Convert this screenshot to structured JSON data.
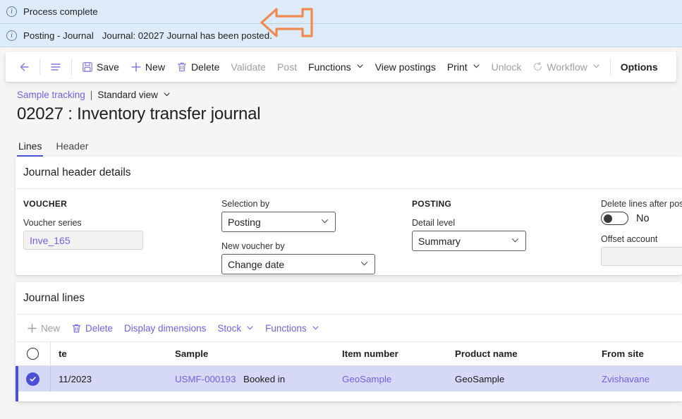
{
  "notifications": [
    {
      "icon": "info-icon",
      "title": "Process complete",
      "detail": ""
    },
    {
      "icon": "info-icon",
      "title": "Posting - Journal",
      "detail": "Journal: 02027 Journal has been posted."
    }
  ],
  "annotation": {
    "shape": "left-arrow",
    "color": "#f08a52"
  },
  "command_bar": {
    "back_label": "",
    "menu_label": "",
    "items": [
      {
        "label": "Save",
        "icon": "save-icon",
        "disabled": false,
        "caret": false
      },
      {
        "label": "New",
        "icon": "plus-icon",
        "disabled": false,
        "caret": false
      },
      {
        "label": "Delete",
        "icon": "trash-icon",
        "disabled": false,
        "caret": false
      },
      {
        "label": "Validate",
        "icon": "",
        "disabled": true,
        "caret": false
      },
      {
        "label": "Post",
        "icon": "",
        "disabled": true,
        "caret": false
      },
      {
        "label": "Functions",
        "icon": "",
        "disabled": false,
        "caret": true
      },
      {
        "label": "View postings",
        "icon": "",
        "disabled": false,
        "caret": false
      },
      {
        "label": "Print",
        "icon": "",
        "disabled": false,
        "caret": true
      },
      {
        "label": "Unlock",
        "icon": "",
        "disabled": true,
        "caret": false
      },
      {
        "label": "Workflow",
        "icon": "workflow-icon",
        "disabled": true,
        "caret": true
      },
      {
        "label": "Options",
        "icon": "",
        "disabled": false,
        "caret": false
      }
    ]
  },
  "breadcrumb": {
    "parent": "Sample tracking",
    "divider": "|",
    "view": "Standard view"
  },
  "page_title": "02027 : Inventory transfer journal",
  "tabs": [
    {
      "label": "Lines",
      "active": true
    },
    {
      "label": "Header",
      "active": false
    }
  ],
  "header_details": {
    "title": "Journal header details",
    "voucher": {
      "group": "VOUCHER",
      "series_label": "Voucher series",
      "series_value": "Inve_165"
    },
    "selection": {
      "selection_by_label": "Selection by",
      "selection_by_value": "Posting",
      "new_voucher_by_label": "New voucher by",
      "new_voucher_by_value": "Change date"
    },
    "posting": {
      "group": "POSTING",
      "detail_level_label": "Detail level",
      "detail_level_value": "Summary"
    },
    "options": {
      "delete_lines_label": "Delete lines after posting",
      "delete_lines_value": "No",
      "offset_account_label": "Offset account",
      "offset_account_value": ""
    }
  },
  "journal_lines": {
    "title": "Journal lines",
    "toolbar": [
      {
        "label": "New",
        "icon": "plus-icon",
        "disabled": true,
        "caret": false
      },
      {
        "label": "Delete",
        "icon": "trash-icon",
        "disabled": false,
        "caret": false
      },
      {
        "label": "Display dimensions",
        "icon": "",
        "disabled": false,
        "caret": false
      },
      {
        "label": "Stock",
        "icon": "",
        "disabled": false,
        "caret": true
      },
      {
        "label": "Functions",
        "icon": "",
        "disabled": false,
        "caret": true
      }
    ],
    "columns": [
      "te",
      "Sample",
      "",
      "Item number",
      "Product name",
      "From site"
    ],
    "rows": [
      {
        "selected": true,
        "date": "11/2023",
        "sample": "USMF-000193",
        "status": "Booked in",
        "item_number": "GeoSample",
        "product_name": "GeoSample",
        "from_site": "Zvishavane"
      }
    ]
  },
  "colors": {
    "accent": "#7160e8",
    "selection": "#4a51d6",
    "notification_bg": "#deecf9",
    "annotation": "#f08a52"
  }
}
